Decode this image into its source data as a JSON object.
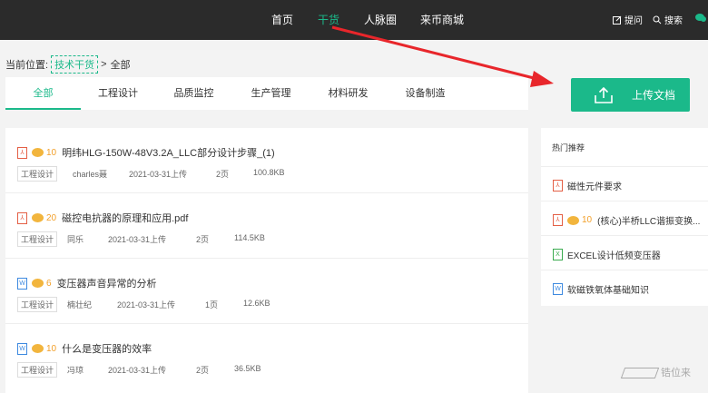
{
  "nav": {
    "items": [
      "首页",
      "干货",
      "人脉圈",
      "来币商城"
    ],
    "active": "干货"
  },
  "top_right": {
    "ask": "提问",
    "search": "搜索"
  },
  "breadcrumb": {
    "prefix": "当前位置:",
    "link": "技术干货",
    "sep": ">",
    "current": "全部"
  },
  "tabs": [
    "全部",
    "工程设计",
    "品质监控",
    "生产管理",
    "材料研发",
    "设备制造"
  ],
  "upload_label": "上传文档",
  "docs": [
    {
      "type": "pdf",
      "coins": "10",
      "title": "明纬HLG-150W-48V3.2A_LLC部分设计步骤_(1)",
      "category": "工程设计",
      "author": "charles聂",
      "date": "2021-03-31上传",
      "pages": "2页",
      "size": "100.8KB"
    },
    {
      "type": "pdf",
      "coins": "20",
      "title": "磁控电抗器的原理和应用.pdf",
      "category": "工程设计",
      "author": "同乐",
      "date": "2021-03-31上传",
      "pages": "2页",
      "size": "114.5KB"
    },
    {
      "type": "word",
      "coins": "6",
      "title": "变压器声音异常的分析",
      "category": "工程设计",
      "author": "楠壮纪",
      "date": "2021-03-31上传",
      "pages": "1页",
      "size": "12.6KB"
    },
    {
      "type": "word",
      "coins": "10",
      "title": "什么是变压器的效率",
      "category": "工程设计",
      "author": "冯琼",
      "date": "2021-03-31上传",
      "pages": "2页",
      "size": "36.5KB"
    }
  ],
  "sidebar": {
    "title": "热门推荐",
    "items": [
      {
        "type": "pdf",
        "coins": "",
        "title": "磁性元件要求"
      },
      {
        "type": "pdf",
        "coins": "10",
        "title": "(核心)半桥LLC谐振变换..."
      },
      {
        "type": "excel",
        "coins": "",
        "title": "EXCEL设计低频变压器"
      },
      {
        "type": "word",
        "coins": "",
        "title": "软磁铁氧体基础知识"
      }
    ]
  },
  "watermark": "锆位来",
  "colors": {
    "accent": "#1bb98a",
    "topbar": "#2b2b2b",
    "arrow": "#e8262b",
    "coin": "#f2b53d"
  }
}
